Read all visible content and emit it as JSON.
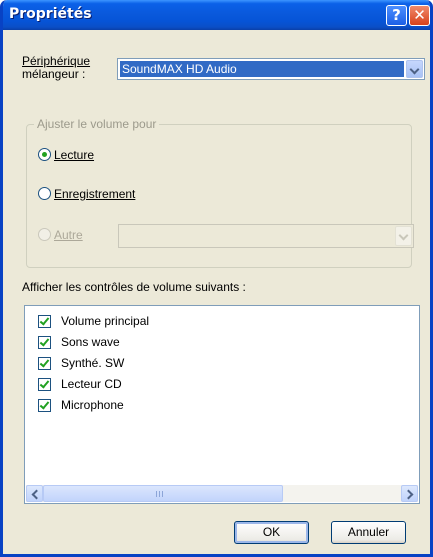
{
  "window": {
    "title": "Propriétés"
  },
  "titlebar_buttons": {
    "help": "?",
    "close": "✕"
  },
  "mixer": {
    "label_line1": "Périphérique",
    "label_line2": "mélangeur :",
    "selected_device": "SoundMAX HD Audio"
  },
  "volume_group": {
    "legend": "Ajuster le volume pour",
    "options": [
      {
        "label": "Lecture",
        "checked": true,
        "enabled": true
      },
      {
        "label": "Enregistrement",
        "checked": false,
        "enabled": true
      },
      {
        "label": "Autre",
        "checked": false,
        "enabled": false
      }
    ]
  },
  "controls": {
    "heading": "Afficher les contrôles de volume suivants :",
    "items": [
      {
        "label": "Volume principal",
        "checked": true
      },
      {
        "label": "Sons wave",
        "checked": true
      },
      {
        "label": "Synthé. SW",
        "checked": true
      },
      {
        "label": "Lecteur CD",
        "checked": true
      },
      {
        "label": "Microphone",
        "checked": true
      }
    ]
  },
  "buttons": {
    "ok": "OK",
    "cancel": "Annuler"
  },
  "icons": {
    "help": "question-mark",
    "close": "x-mark",
    "dropdown": "chevron-down",
    "scroll_left": "chevron-left",
    "scroll_right": "chevron-right",
    "checkmark": "check"
  },
  "colors": {
    "titlebar": "#0a59dc",
    "selection": "#316ac5",
    "dialog_bg": "#ece9d8",
    "check": "#21a121"
  }
}
